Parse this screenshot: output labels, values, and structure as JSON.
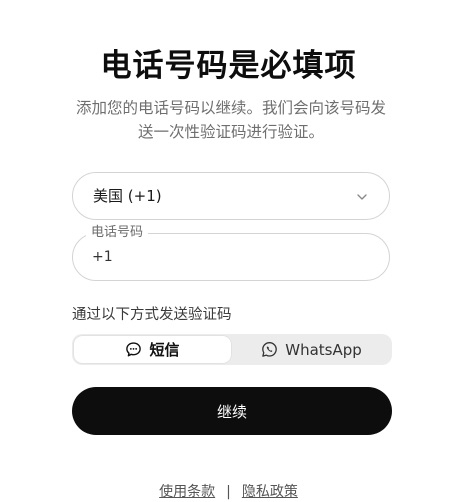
{
  "header": {
    "title": "电话号码是必填项",
    "subtitle": "添加您的电话号码以继续。我们会向该号码发送一次性验证码进行验证。"
  },
  "country_select": {
    "value": "美国 (+1)",
    "icon": "chevron-down-icon"
  },
  "phone_field": {
    "label": "电话号码",
    "value": "+1",
    "placeholder": ""
  },
  "delivery_method": {
    "label": "通过以下方式发送验证码",
    "options": [
      {
        "label": "短信",
        "icon": "message-icon",
        "selected": true
      },
      {
        "label": "WhatsApp",
        "icon": "whatsapp-icon",
        "selected": false
      }
    ]
  },
  "continue_button": {
    "label": "继续"
  },
  "footer": {
    "terms_label": "使用条款",
    "separator": "|",
    "privacy_label": "隐私政策"
  },
  "colors": {
    "primary_button": "#0d0d0d",
    "border": "#d4d4d4",
    "segment_bg": "#ececec",
    "muted_text": "#6f6f6f"
  }
}
